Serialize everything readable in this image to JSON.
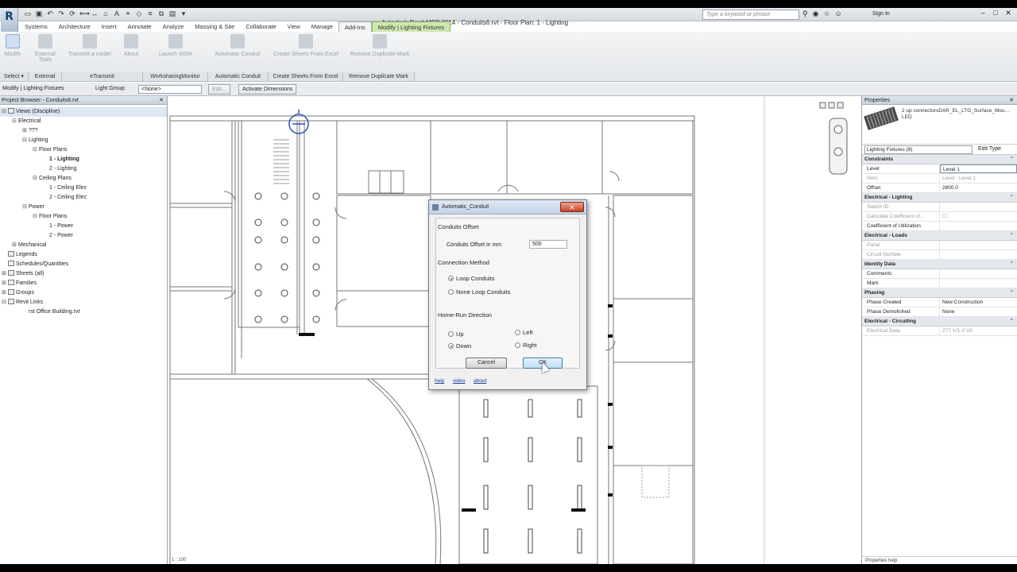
{
  "window": {
    "title": "Autodesk Revit MEP 2014 -   Conduits6.rvt - Floor Plan: 1 - Lighting",
    "search_placeholder": "Type a keyword or phrase",
    "sign_in": "Sign In",
    "app_logo": "R",
    "minimize": "–",
    "maximize": "□",
    "close": "✕"
  },
  "ribbon": {
    "tabs": [
      "Systems",
      "Architecture",
      "Insert",
      "Annotate",
      "Analyze",
      "Massing & Site",
      "Collaborate",
      "View",
      "Manage",
      "Add-Ins",
      "Modify | Lighting Fixtures"
    ],
    "active_tab": "Add-Ins",
    "buttons": {
      "modify": "Modify",
      "external_tools": "External Tools",
      "transmit": "Transmit a model",
      "worksharing_monitor": "Launch WSM",
      "help": "Help",
      "about": "About",
      "automatic_conduit": "Automatic Conduit",
      "create_sheets": "Create Sheets From Excel",
      "remove_duplicate_mark": "Remove Duplicate Mark"
    },
    "panels": {
      "select": "Select ▾",
      "external": "External",
      "etransmit": "eTransmit",
      "worksharing": "WorksharingMonitor",
      "automatic_conduit": "Automatic Conduit",
      "create_sheets": "Create Sheets From Excel",
      "remove_duplicate": "Remove Duplicate Mark"
    }
  },
  "options_bar": {
    "context": "Modify | Lighting Fixtures",
    "light_group_label": "Light Group:",
    "light_group_value": "<None>",
    "edit": "Edit...",
    "activate_dimensions": "Activate Dimensions"
  },
  "project_browser": {
    "title": "Project Browser - Conduits6.rvt",
    "close": "✕",
    "nodes": [
      {
        "label": "Views (Discipline)",
        "depth": 0,
        "toggle": "⊟",
        "icon": true,
        "highlight": true
      },
      {
        "label": "Electrical",
        "depth": 1,
        "toggle": "⊟"
      },
      {
        "label": "???",
        "depth": 2,
        "toggle": "⊞"
      },
      {
        "label": "Lighting",
        "depth": 2,
        "toggle": "⊟"
      },
      {
        "label": "Floor Plans",
        "depth": 3,
        "toggle": "⊟"
      },
      {
        "label": "1 - Lighting",
        "depth": 4,
        "toggle": "",
        "bold": true
      },
      {
        "label": "2 - Lighting",
        "depth": 4,
        "toggle": ""
      },
      {
        "label": "Ceiling Plans",
        "depth": 3,
        "toggle": "⊟"
      },
      {
        "label": "1 - Ceiling Elec",
        "depth": 4,
        "toggle": ""
      },
      {
        "label": "2 - Ceiling Elec",
        "depth": 4,
        "toggle": ""
      },
      {
        "label": "Power",
        "depth": 2,
        "toggle": "⊟"
      },
      {
        "label": "Floor Plans",
        "depth": 3,
        "toggle": "⊟"
      },
      {
        "label": "1 - Power",
        "depth": 4,
        "toggle": ""
      },
      {
        "label": "2 - Power",
        "depth": 4,
        "toggle": ""
      },
      {
        "label": "Mechanical",
        "depth": 1,
        "toggle": "⊞"
      },
      {
        "label": "Legends",
        "depth": 0,
        "toggle": "",
        "icon": true
      },
      {
        "label": "Schedules/Quantities",
        "depth": 0,
        "toggle": "",
        "icon": true
      },
      {
        "label": "Sheets (all)",
        "depth": 0,
        "toggle": "⊞",
        "icon": true
      },
      {
        "label": "Families",
        "depth": 0,
        "toggle": "⊞",
        "icon": true
      },
      {
        "label": "Groups",
        "depth": 0,
        "toggle": "⊞",
        "icon": true
      },
      {
        "label": "Revit Links",
        "depth": 0,
        "toggle": "⊟",
        "icon": true
      },
      {
        "label": "rst Office Building.rvt",
        "depth": 2,
        "toggle": ""
      }
    ]
  },
  "dialog": {
    "title": "Automatic_Conduit",
    "close": "✕",
    "offset_section": "Conduits Offset",
    "offset_label": "Conduits Offset in mm",
    "offset_value": "500",
    "method_section": "Connection Method",
    "method_options": [
      "Loop Conduits",
      "None Loop Conduits"
    ],
    "method_selected": "Loop Conduits",
    "direction_section": "Home-Run Direction",
    "direction_options": [
      "Up",
      "Down",
      "Left",
      "Right"
    ],
    "direction_selected": "Down",
    "cancel": "Cancel",
    "ok": "OK",
    "links": [
      "help",
      "video",
      "about"
    ]
  },
  "properties": {
    "title": "Properties",
    "close": "✕",
    "type_name": "2 up connectorsDAR_EL_LTG_Surface_Mou... LED",
    "family_filter": "Lighting Fixtures (8)",
    "edit_type": "Edit Type",
    "groups": [
      {
        "name": "Constraints",
        "rows": [
          {
            "key": "Level",
            "value": "Level 1",
            "editing": true
          },
          {
            "key": "Host",
            "value": "Level : Level 1",
            "dim": true
          },
          {
            "key": "Offset",
            "value": "2800.0"
          }
        ]
      },
      {
        "name": "Electrical - Lighting",
        "rows": [
          {
            "key": "Switch ID",
            "value": "",
            "dim": true
          },
          {
            "key": "Calculate Coefficient of...",
            "value": "☐",
            "dim": true
          },
          {
            "key": "Coefficient of Utilization",
            "value": ""
          }
        ]
      },
      {
        "name": "Electrical - Loads",
        "rows": [
          {
            "key": "Panel",
            "value": "",
            "dim": true
          },
          {
            "key": "Circuit Number",
            "value": "",
            "dim": true
          }
        ]
      },
      {
        "name": "Identity Data",
        "rows": [
          {
            "key": "Comments",
            "value": ""
          },
          {
            "key": "Mark",
            "value": ""
          }
        ]
      },
      {
        "name": "Phasing",
        "rows": [
          {
            "key": "Phase Created",
            "value": "New Construction"
          },
          {
            "key": "Phase Demolished",
            "value": "None"
          }
        ]
      },
      {
        "name": "Electrical - Circuiting",
        "rows": [
          {
            "key": "Electrical Data",
            "value": "277 V/1-0 VA",
            "dim": true
          }
        ]
      }
    ],
    "footer": "Properties help",
    "apply": "Apply"
  },
  "canvas": {
    "scale": "1 : 100"
  }
}
